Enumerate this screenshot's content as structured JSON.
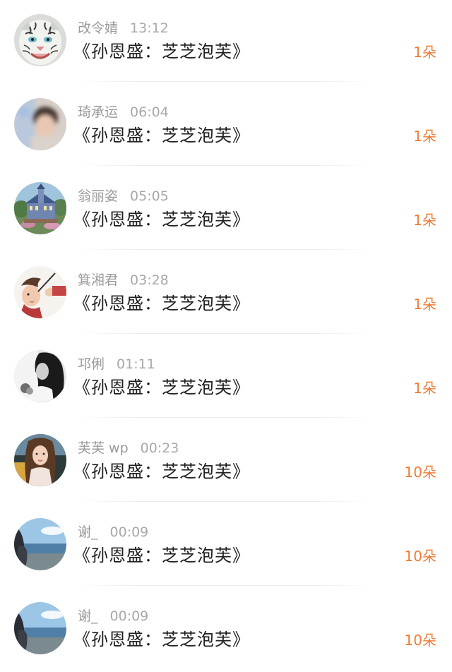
{
  "gift_list": [
    {
      "name": "改令婧",
      "time": "13:12",
      "title": "《孙恩盛：芝芝泡芙》",
      "count": "1朵",
      "avatar_icon": "white-tiger-avatar"
    },
    {
      "name": "琦承运",
      "time": "06:04",
      "title": "《孙恩盛：芝芝泡芙》",
      "count": "1朵",
      "avatar_icon": "blurred-portrait-avatar"
    },
    {
      "name": "翁丽姿",
      "time": "05:05",
      "title": "《孙恩盛：芝芝泡芙》",
      "count": "1朵",
      "avatar_icon": "castle-painting-avatar"
    },
    {
      "name": "箕湘君",
      "time": "03:28",
      "title": "《孙恩盛：芝芝泡芙》",
      "count": "1朵",
      "avatar_icon": "cartoon-man-avatar"
    },
    {
      "name": "邛俐",
      "time": "01:11",
      "title": "《孙恩盛：芝芝泡芙》",
      "count": "1朵",
      "avatar_icon": "bw-girl-avatar"
    },
    {
      "name": "芙芙 wp",
      "time": "00:23",
      "title": "《孙恩盛：芝芝泡芙》",
      "count": "10朵",
      "avatar_icon": "girl-selfie-avatar"
    },
    {
      "name": "谢_",
      "time": "00:09",
      "title": "《孙恩盛：芝芝泡芙》",
      "count": "10朵",
      "avatar_icon": "seaside-avatar"
    },
    {
      "name": "谢_",
      "time": "00:09",
      "title": "《孙恩盛：芝芝泡芙》",
      "count": "10朵",
      "avatar_icon": "seaside-avatar"
    }
  ],
  "colors": {
    "count_accent": "#f07a35",
    "name_gray": "#9b9b9b",
    "title_text": "#1f1f1f"
  }
}
